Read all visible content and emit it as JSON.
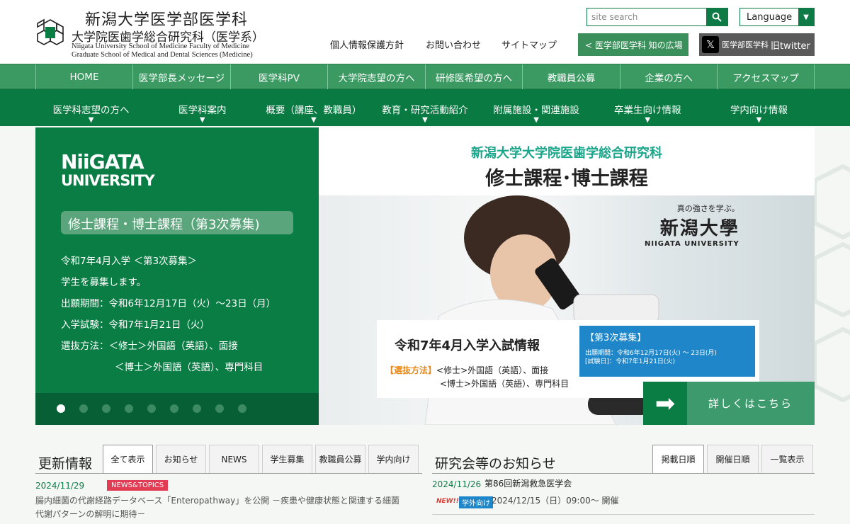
{
  "header": {
    "title_ja": "新潟大学医学部医学科",
    "subtitle_ja": "大学院医歯学総合研究科（医学系）",
    "title_en_1": "Niigata University School of Medicine Faculty of Medicine",
    "title_en_2": "Graduate School of Medical and Dental Sciences (Medicine)",
    "search_placeholder": "site search",
    "language_label": "Language",
    "util_links": [
      "個人情報保護方針",
      "お問い合わせ",
      "サイトマップ"
    ],
    "chisen_button": "<  医学部医学科 知の広場",
    "twitter_label": "医学部医学科",
    "twitter_suffix": "旧twitter"
  },
  "nav_primary": [
    "HOME",
    "医学部長メッセージ",
    "医学科PV",
    "大学院志望の方へ",
    "研修医希望の方へ",
    "教職員公募",
    "企業の方へ",
    "アクセスマップ"
  ],
  "nav_secondary": [
    "医学科志望の方へ",
    "医学科案内",
    "概要（講座、教職員）",
    "教育・研究活動紹介",
    "附属施設・関連施設",
    "卒業生向け情報",
    "学内向け情報"
  ],
  "slider": {
    "logo_line1": "NiiGATA",
    "logo_line2": "UNIVERSITY",
    "title": "修士課程・博士課程（第3次募集)",
    "lines": [
      "令和7年4月入学 ＜第3次募集＞",
      "学生を募集します。",
      "出願期間：令和6年12月17日（火）～23日（月）",
      "入学試験：令和7年1月21日（火）",
      "選抜方法：＜修士＞外国語（英語）、面接",
      "＜博士＞外国語（英語）、専門科目"
    ],
    "dot_count": 9,
    "active_dot": 0,
    "banner_heading": "新潟大学大学院医歯学総合研究科",
    "banner_title": "修士課程･博士課程",
    "nu_tagline": "真の強さを学ぶ。",
    "nu_name": "新潟大學",
    "nu_en": "NIIGATA UNIVERSITY",
    "info_title": "令和7年4月入学入試情報",
    "info_method_label": "【選抜方法】",
    "info_method_1": "<修士>外国語（英語）、面接",
    "info_method_2": "<博士>外国語（英語）、専門科目",
    "blue_title": "【第3次募集】",
    "blue_line1": "出願期間：令和6年12月17日(火) ～ 23日(月)",
    "blue_line2": "[試験日]：令和7年1月21日(火)",
    "more_label": "詳しくはこちら"
  },
  "news": {
    "title": "更新情報",
    "tabs": [
      "全て表示",
      "お知らせ",
      "NEWS",
      "学生募集",
      "教職員公募",
      "学内向け"
    ],
    "active_tab": 0,
    "items": [
      {
        "date": "2024/11/29",
        "tag": "NEWS&TOPICS",
        "text_1": "腸内細菌の代謝経路データベース「Enteropathway」を公開 －疾患や健康状態と関連する細菌",
        "text_2": "代謝パターンの解明に期待－"
      }
    ]
  },
  "study": {
    "title": "研究会等のお知らせ",
    "tabs": [
      "掲載日順",
      "開催日順",
      "一覧表示"
    ],
    "active_tab": 0,
    "items": [
      {
        "date": "2024/11/26",
        "title": "第86回新潟救急医学会",
        "new_badge": "NEW!!",
        "tag": "学外向け",
        "when": "2024/12/15（日）09:00～ 開催"
      }
    ]
  },
  "colors": {
    "brand_green": "#0a7d45",
    "nav_green": "#3a9a62",
    "news_tag": "#e23b54",
    "info_blue": "#1f87c9"
  }
}
